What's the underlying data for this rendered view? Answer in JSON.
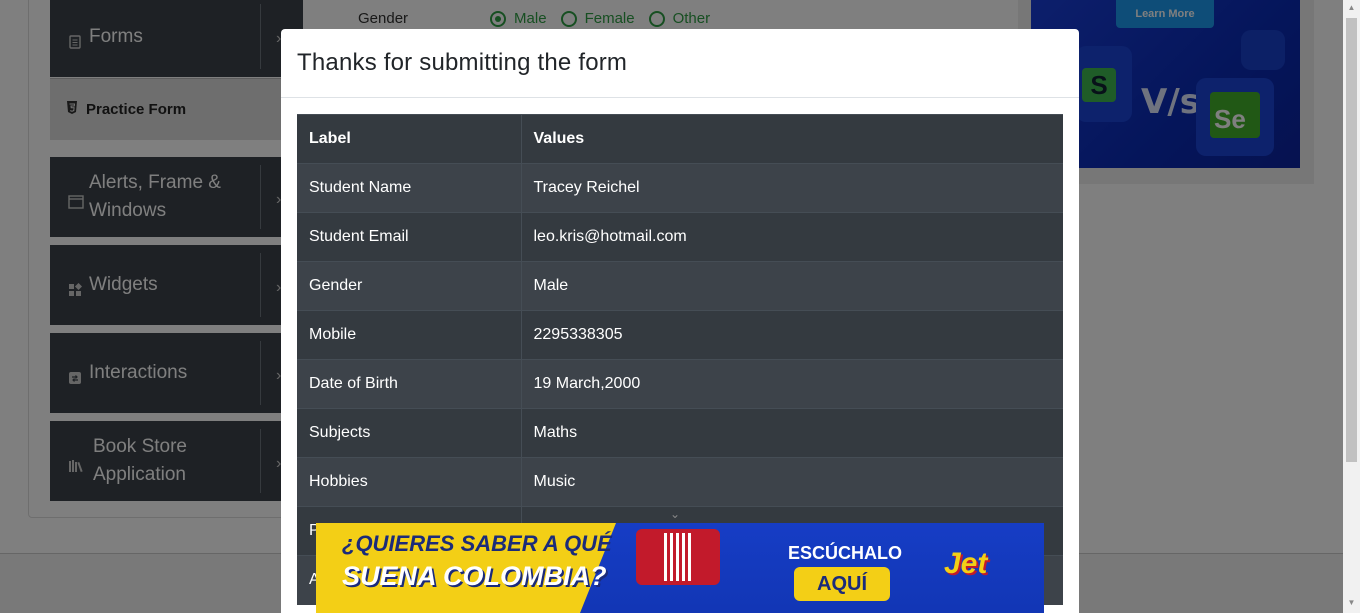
{
  "sidebar": {
    "groups": [
      {
        "label": "Forms",
        "icon": "document-icon"
      },
      {
        "label": "Alerts, Frame & Windows",
        "icon": "window-icon"
      },
      {
        "label": "Widgets",
        "icon": "widgets-icon"
      },
      {
        "label": "Interactions",
        "icon": "interactions-icon"
      },
      {
        "label": "Book Store Application",
        "icon": "books-icon"
      }
    ],
    "active_item": "Practice Form"
  },
  "form": {
    "gender_label": "Gender",
    "gender_options": [
      "Male",
      "Female",
      "Other"
    ],
    "gender_selected": "Male"
  },
  "ad_top": {
    "button": "Learn More",
    "vs_text": "V/s",
    "logo_text": "Se"
  },
  "modal": {
    "title": "Thanks for submitting the form",
    "table": {
      "headers": [
        "Label",
        "Values"
      ],
      "rows": [
        [
          "Student Name",
          "Tracey Reichel"
        ],
        [
          "Student Email",
          "leo.kris@hotmail.com"
        ],
        [
          "Gender",
          "Male"
        ],
        [
          "Mobile",
          "2295338305"
        ],
        [
          "Date of Birth",
          "19 March,2000"
        ],
        [
          "Subjects",
          "Maths"
        ],
        [
          "Hobbies",
          "Music"
        ],
        [
          "P",
          ""
        ],
        [
          "A",
          ""
        ]
      ]
    }
  },
  "ad_bottom": {
    "line1": "¿QUIERES SABER A QUÉ",
    "line2": "SUENA COLOMBIA?",
    "cta_top": "ESCÚCHALO",
    "cta": "AQUÍ",
    "brand": "Jet"
  },
  "colors": {
    "sidebar_bg": "#3d434a",
    "table_bg": "#343a40",
    "radio_green": "#2f9e44",
    "ad_blue": "#1236b5",
    "ad_yellow": "#f3cf16"
  }
}
